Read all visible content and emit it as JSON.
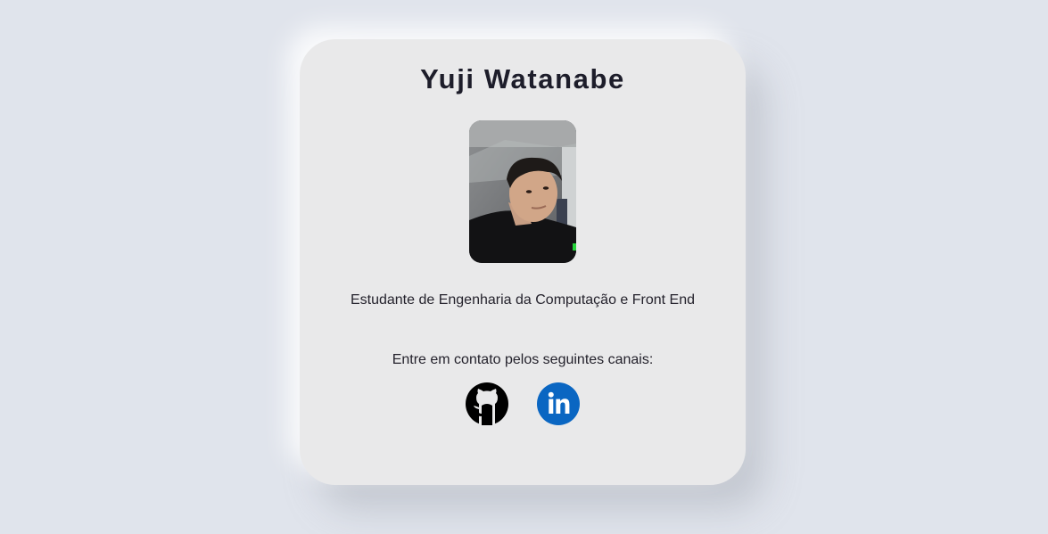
{
  "profile": {
    "name": "Yuji Watanabe",
    "description": "Estudante de Engenharia da Computação e Front End",
    "contact_text": "Entre em contato pelos seguintes canais:"
  },
  "social_links": [
    {
      "icon": "github-icon",
      "color": "#000000"
    },
    {
      "icon": "linkedin-icon",
      "color": "#0a66c2"
    }
  ],
  "colors": {
    "background": "#e0e4ec",
    "card": "#e9e9ea",
    "text": "#1d1d2a"
  }
}
